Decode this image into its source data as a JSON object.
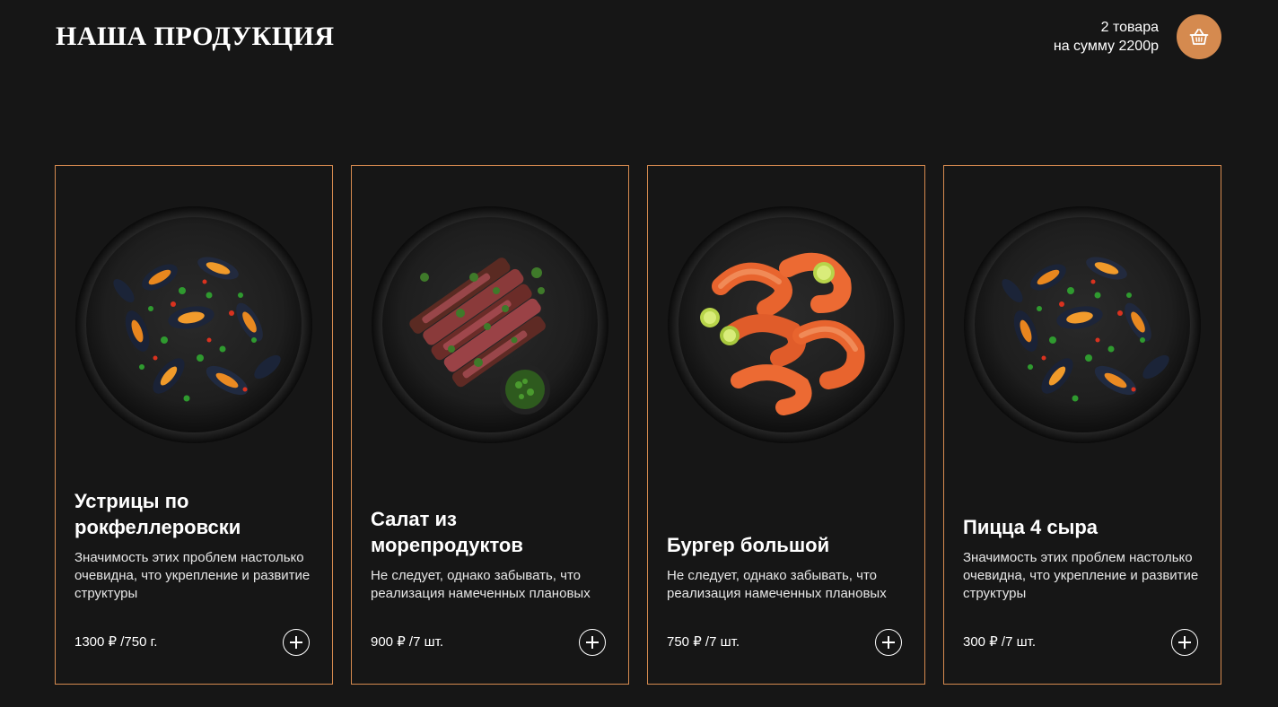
{
  "header": {
    "title": "НАША ПРОДУКЦИЯ",
    "cart": {
      "count_text": "2 товара",
      "sum_text": "на сумму 2200р",
      "icon": "basket-icon",
      "accent_color": "#d58a4f"
    }
  },
  "products": [
    {
      "title": "Устрицы по рокфеллеровски",
      "description": "Значимость этих проблем настолько очевидна, что укрепление и развитие структуры",
      "price": "1300 ₽  /750 г.",
      "image": "mussels-dish",
      "add_icon": "plus-icon"
    },
    {
      "title": "Салат из морепродуктов",
      "description": "Не следует, однако забывать, что реализация намеченных плановых",
      "price": "900 ₽  /7 шт.",
      "image": "steak-dish",
      "add_icon": "plus-icon"
    },
    {
      "title": "Бургер большой",
      "description": "Не следует, однако забывать, что реализация намеченных плановых",
      "price": "750 ₽  /7 шт.",
      "image": "shrimp-dish",
      "add_icon": "plus-icon"
    },
    {
      "title": "Пицца 4 сыра",
      "description": "Значимость этих проблем настолько очевидна, что укрепление и развитие структуры",
      "price": "300 ₽  /7 шт.",
      "image": "mussels-dish",
      "add_icon": "plus-icon"
    }
  ]
}
